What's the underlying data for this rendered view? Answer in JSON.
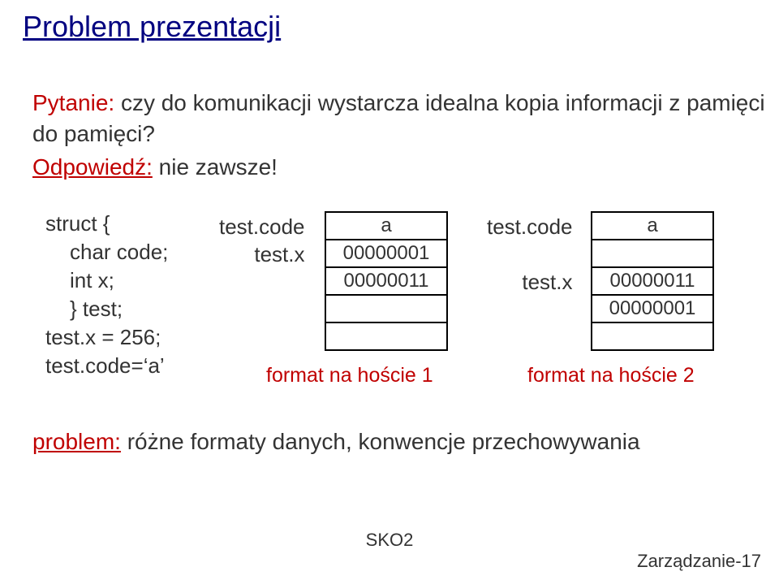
{
  "title": "Problem prezentacji",
  "question": {
    "label": "Pytanie:",
    "text": " czy do komunikacji wystarcza idealna kopia informacji z pamięci do pamięci?"
  },
  "answer": {
    "label": "Odpowiedź:",
    "text": " nie zawsze!"
  },
  "struct": {
    "l1": "struct {",
    "l2": "char code;",
    "l3": "int x;",
    "l4": "} test;",
    "l5": "test.x = 256;",
    "l6": "test.code=‘a’"
  },
  "host1": {
    "label_code": "test.code",
    "label_x": "test.x",
    "rows": [
      "a",
      "00000001",
      "00000011",
      "",
      ""
    ],
    "caption": "format na hoście 1"
  },
  "host2": {
    "label_code": "test.code",
    "label_x": "test.x",
    "rows": [
      "a",
      "",
      "00000011",
      "00000001",
      ""
    ],
    "caption": "format na hoście 2"
  },
  "problem": {
    "label": "problem:",
    "text": " różne formaty danych, konwencje przechowywania"
  },
  "footer": {
    "center": "SKO2",
    "right": "Zarządzanie-17"
  }
}
